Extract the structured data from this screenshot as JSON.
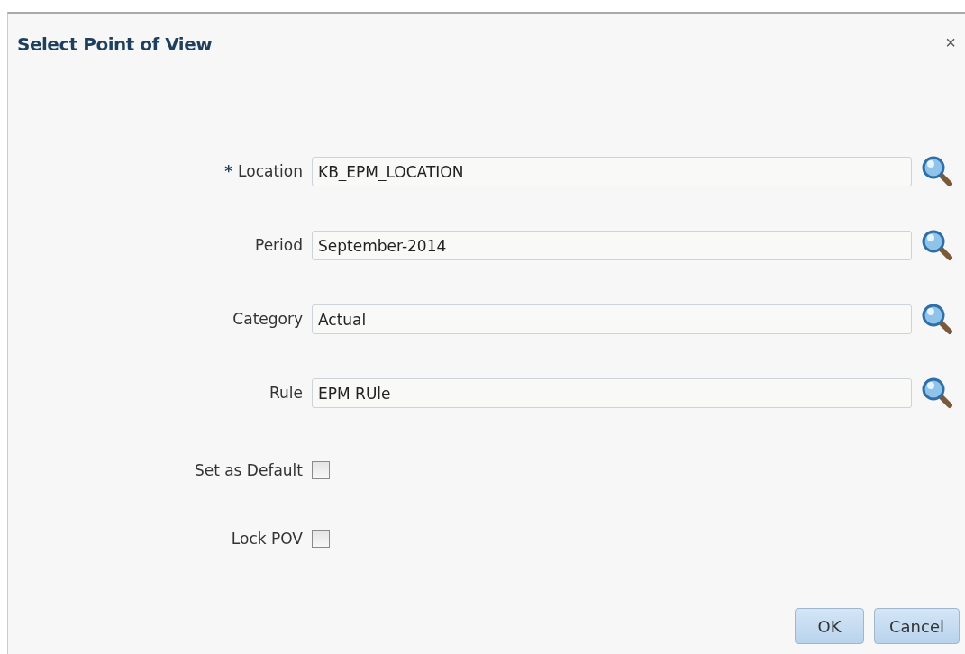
{
  "dialog": {
    "title": "Select Point of View",
    "close": "×"
  },
  "fields": [
    {
      "label": "Location",
      "required_mark": "*",
      "value": "KB_EPM_LOCATION"
    },
    {
      "label": "Period",
      "value": "September-2014"
    },
    {
      "label": "Category",
      "value": "Actual"
    },
    {
      "label": "Rule",
      "value": "EPM RUle"
    }
  ],
  "options": [
    {
      "label": "Set as Default",
      "checked": false
    },
    {
      "label": "Lock POV",
      "checked": false
    }
  ],
  "buttons": [
    "OK",
    "Cancel"
  ]
}
